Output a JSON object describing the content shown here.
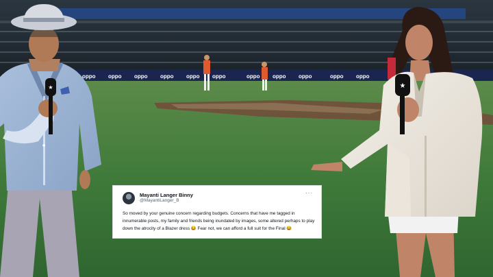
{
  "scene": {
    "board_text": "oppo",
    "broadcaster_mark": "star-logo"
  },
  "tweet": {
    "author_name": "Mayanti Langer Binny",
    "author_handle": "@MayantiLanger_B",
    "more_glyph": "···",
    "body": "So moved by your genuine concern regarding budgets. Concerns that have me tagged in innumerable posts, my family and friends being inundated by images, some altered perhaps to play down the atrocity of a Blazer dress 😂 Fear not, we can afford a full suit for the Final 😂"
  },
  "colors": {
    "pitch": "#3f7a3a",
    "stand": "#27313a",
    "banner": "#244a8f",
    "card": "#ffffff"
  }
}
